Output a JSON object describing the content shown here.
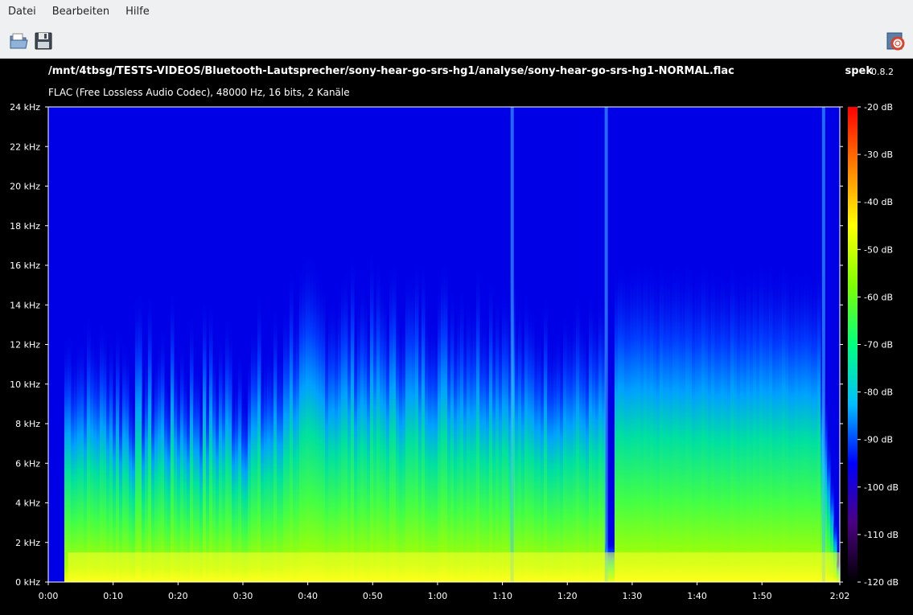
{
  "menu": {
    "items": [
      "Datei",
      "Bearbeiten",
      "Hilfe"
    ]
  },
  "toolbar": {
    "open_icon": "open-file-icon",
    "save_icon": "save-icon",
    "help_icon": "help-lifebuoy-icon"
  },
  "header": {
    "file_path": "/mnt/4tbsg/TESTS-VIDEOS/Bluetooth-Lautsprecher/sony-hear-go-srs-hg1/analyse/sony-hear-go-srs-hg1-NORMAL.flac",
    "file_info": "FLAC (Free Lossless Audio Codec), 48000 Hz, 16 bits, 2 Kanäle",
    "app_name": "spek",
    "app_version": "0.8.2"
  },
  "chart_data": {
    "type": "heatmap",
    "x_tick_labels": [
      "0:00",
      "0:10",
      "0:20",
      "0:30",
      "0:40",
      "0:50",
      "1:00",
      "1:10",
      "1:20",
      "1:30",
      "1:40",
      "1:50",
      "2:02"
    ],
    "x_tick_seconds": [
      0,
      10,
      20,
      30,
      40,
      50,
      60,
      70,
      80,
      90,
      100,
      110,
      122
    ],
    "x_range_seconds": [
      0,
      122
    ],
    "y_tick_labels": [
      "0 kHz",
      "2 kHz",
      "4 kHz",
      "6 kHz",
      "8 kHz",
      "10 kHz",
      "12 kHz",
      "14 kHz",
      "16 kHz",
      "18 kHz",
      "20 kHz",
      "22 kHz",
      "24 kHz"
    ],
    "y_tick_khz": [
      0,
      2,
      4,
      6,
      8,
      10,
      12,
      14,
      16,
      18,
      20,
      22,
      24
    ],
    "y_range_khz": [
      0,
      24
    ],
    "colorbar_labels": [
      "-20 dB",
      "-30 dB",
      "-40 dB",
      "-50 dB",
      "-60 dB",
      "-70 dB",
      "-80 dB",
      "-90 dB",
      "-100 dB",
      "-110 dB",
      "-120 dB"
    ],
    "colorbar_db": [
      -20,
      -30,
      -40,
      -50,
      -60,
      -70,
      -80,
      -90,
      -100,
      -110,
      -120
    ],
    "colorbar_range_db": [
      -120,
      -20
    ],
    "colorbar_colors": [
      "#000000",
      "#4b0082",
      "#0000ff",
      "#00bfff",
      "#00ff7f",
      "#7fff00",
      "#ffff00",
      "#ff8000",
      "#ff0000"
    ],
    "background_color": "#0000e6"
  }
}
